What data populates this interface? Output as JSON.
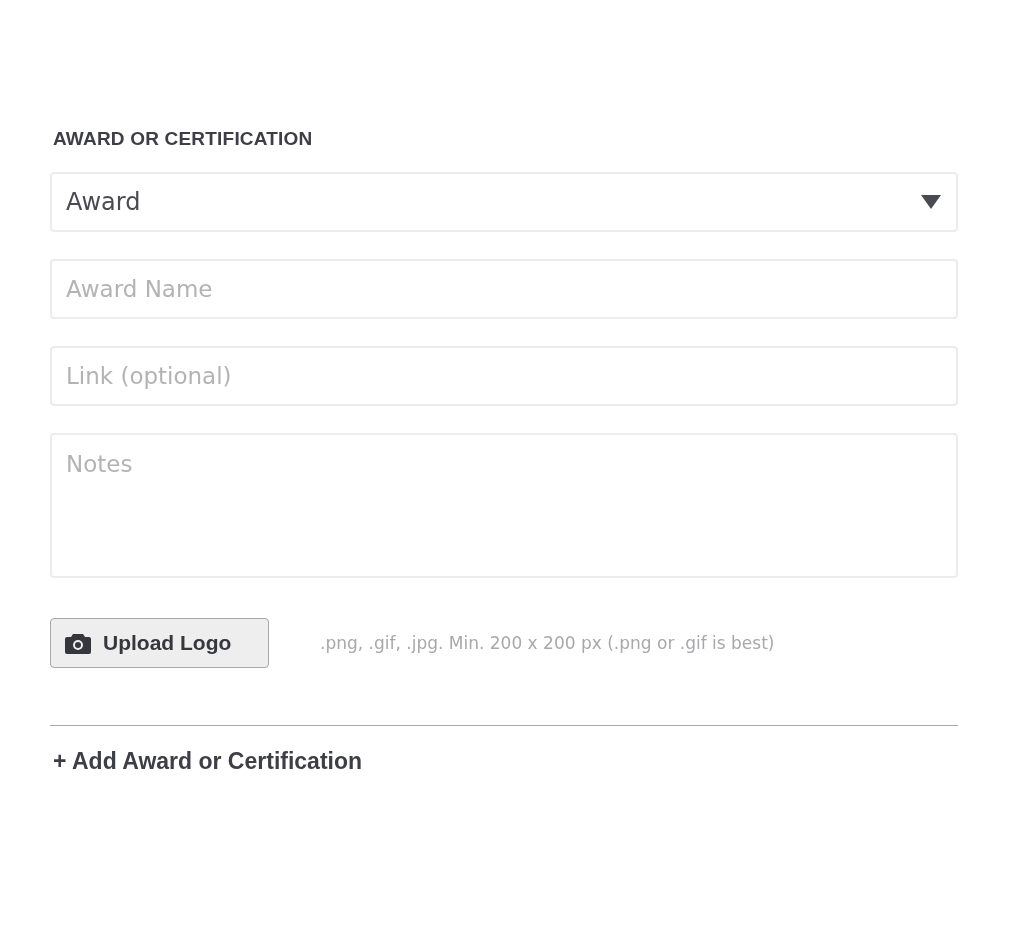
{
  "section_title": "AWARD OR CERTIFICATION",
  "fields": [
    {
      "kind": "select",
      "value": "Award"
    },
    {
      "kind": "input",
      "placeholder": "Award Name"
    },
    {
      "kind": "input",
      "placeholder": "Link (optional)"
    },
    {
      "kind": "textarea",
      "placeholder": "Notes"
    }
  ],
  "upload_button": {
    "label": "Upload Logo"
  },
  "upload_hint": ".png, .gif, .jpg. Min. 200 x 200 px (.png or .gif is best)",
  "add_link": "+ Add Award or Certification"
}
